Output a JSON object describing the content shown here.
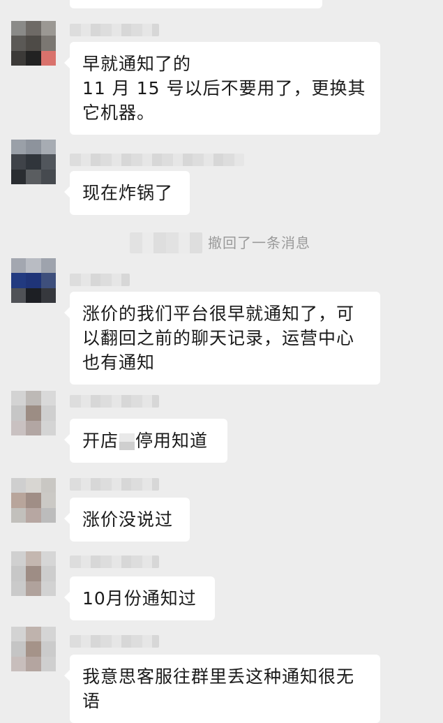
{
  "messages": [
    {
      "lines": [
        "早就通知了的",
        "11 月 15 号以后不要用了，更换其",
        "它机器。"
      ]
    },
    {
      "lines": [
        "现在炸锅了"
      ]
    },
    {
      "lines": [
        "涨价的我们平台很早就通知了，可",
        "以翻回之前的聊天记录，运营中心",
        "也有通知"
      ]
    },
    {
      "pre": "开店",
      "post": "停用知道"
    },
    {
      "lines": [
        "涨价没说过"
      ]
    },
    {
      "lines": [
        "10月份通知过"
      ]
    },
    {
      "lines": [
        "我意思客服往群里丢这种通知很无",
        "语"
      ]
    }
  ],
  "system_notice": "撤回了一条消息"
}
